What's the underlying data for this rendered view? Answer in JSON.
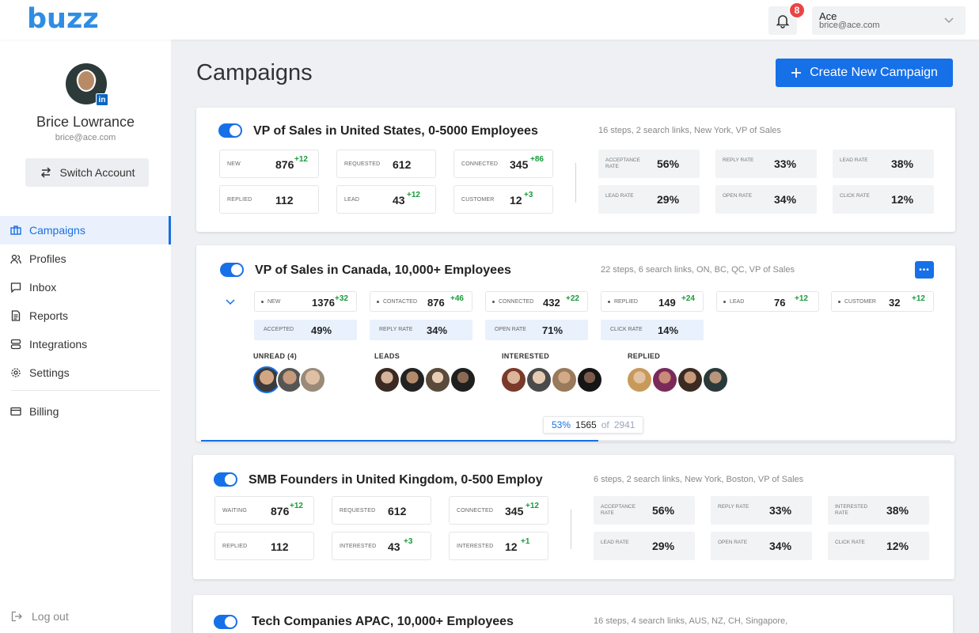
{
  "app": {
    "logo": "buzz"
  },
  "header": {
    "notifications_count": "8",
    "account_name": "Ace",
    "account_email": "brice@ace.com"
  },
  "sidebar": {
    "user_name": "Brice Lowrance",
    "user_email": "brice@ace.com",
    "linkedin_badge": "in",
    "switch_account": "Switch Account",
    "nav": [
      {
        "label": "Campaigns",
        "icon": "briefcase-icon",
        "active": true
      },
      {
        "label": "Profiles",
        "icon": "users-icon"
      },
      {
        "label": "Inbox",
        "icon": "chat-icon"
      },
      {
        "label": "Reports",
        "icon": "document-icon"
      },
      {
        "label": "Integrations",
        "icon": "database-icon"
      },
      {
        "label": "Settings",
        "icon": "gear-icon"
      }
    ],
    "billing": "Billing",
    "logout": "Log out"
  },
  "main": {
    "title": "Campaigns",
    "create_button": "Create New Campaign",
    "campaigns": [
      {
        "title": "VP of Sales in United States, 0-5000 Employees",
        "meta": "16 steps, 2 search links, New York, VP of Sales",
        "stats": [
          {
            "label": "NEW",
            "value": "876",
            "delta": "+12"
          },
          {
            "label": "REQUESTED",
            "value": "612",
            "delta": ""
          },
          {
            "label": "CONNECTED",
            "value": "345",
            "delta": "+86"
          },
          {
            "label": "REPLIED",
            "value": "112",
            "delta": ""
          },
          {
            "label": "LEAD",
            "value": "43",
            "delta": "+12"
          },
          {
            "label": "CUSTOMER",
            "value": "12",
            "delta": "+3"
          }
        ],
        "rates": [
          {
            "label": "ACCEPTANCE RATE",
            "value": "56%"
          },
          {
            "label": "REPLY RATE",
            "value": "33%"
          },
          {
            "label": "LEAD RATE",
            "value": "38%"
          },
          {
            "label": "LEAD RATE",
            "value": "29%"
          },
          {
            "label": "OPEN RATE",
            "value": "34%"
          },
          {
            "label": "CLICK RATE",
            "value": "12%"
          }
        ]
      },
      {
        "title": "VP of Sales in Canada, 10,000+ Employees",
        "meta": "22 steps, 6 search links, ON, BC, QC, VP of Sales",
        "more": "•••",
        "stats": [
          {
            "label": "NEW",
            "value": "1376",
            "delta": "+32"
          },
          {
            "label": "CONTACTED",
            "value": "876",
            "delta": "+46"
          },
          {
            "label": "CONNECTED",
            "value": "432",
            "delta": "+22"
          },
          {
            "label": "REPLIED",
            "value": "149",
            "delta": "+24"
          },
          {
            "label": "LEAD",
            "value": "76",
            "delta": "+12"
          },
          {
            "label": "CUSTOMER",
            "value": "32",
            "delta": "+12"
          }
        ],
        "rates": [
          {
            "label": "ACCEPTED",
            "value": "49%"
          },
          {
            "label": "REPLY RATE",
            "value": "34%"
          },
          {
            "label": "OPEN RATE",
            "value": "71%"
          },
          {
            "label": "CLICK RATE",
            "value": "14%"
          }
        ],
        "groups": [
          {
            "label": "UNREAD (4)"
          },
          {
            "label": "LEADS"
          },
          {
            "label": "INTERESTED"
          },
          {
            "label": "REPLIED"
          }
        ],
        "progress": {
          "percent": "53%",
          "done": "1565",
          "of": "of",
          "total": "2941",
          "fraction": 0.53
        }
      },
      {
        "title": "SMB Founders in United Kingdom, 0-500 Employ",
        "meta": "6 steps, 2 search links, New York, Boston, VP of Sales",
        "stats": [
          {
            "label": "WAITING",
            "value": "876",
            "delta": "+12"
          },
          {
            "label": "REQUESTED",
            "value": "612",
            "delta": ""
          },
          {
            "label": "CONNECTED",
            "value": "345",
            "delta": "+12"
          },
          {
            "label": "REPLIED",
            "value": "112",
            "delta": ""
          },
          {
            "label": "INTERESTED",
            "value": "43",
            "delta": "+3"
          },
          {
            "label": "INTERESTED",
            "value": "12",
            "delta": "+1"
          }
        ],
        "rates": [
          {
            "label": "ACCEPTANCE RATE",
            "value": "56%"
          },
          {
            "label": "REPLY RATE",
            "value": "33%"
          },
          {
            "label": "INTERESTED RATE",
            "value": "38%"
          },
          {
            "label": "LEAD RATE",
            "value": "29%"
          },
          {
            "label": "OPEN RATE",
            "value": "34%"
          },
          {
            "label": "CLICK RATE",
            "value": "12%"
          }
        ]
      },
      {
        "title": "Tech Companies APAC, 10,000+ Employees",
        "meta": "16 steps, 4 search links, AUS, NZ, CH, Singapore,"
      }
    ]
  }
}
